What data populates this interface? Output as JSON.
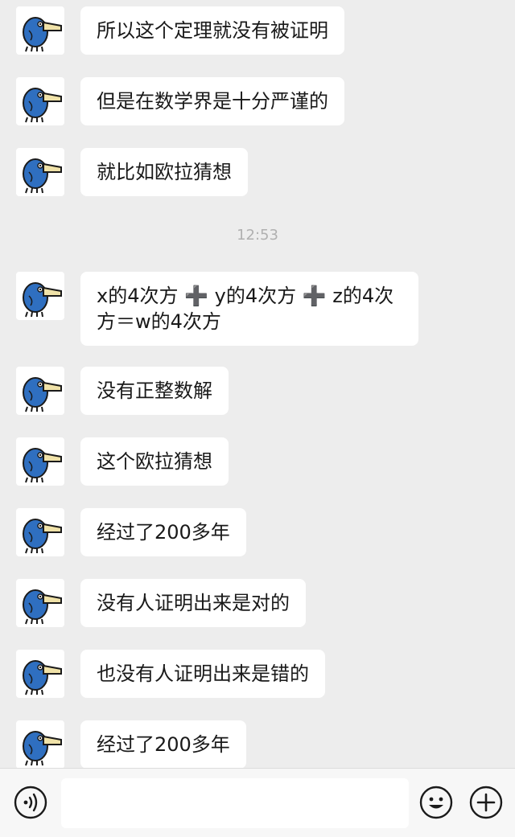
{
  "chat": {
    "timestamp": "12:53",
    "messages": [
      {
        "text": "所以这个定理就没有被证明"
      },
      {
        "text": "但是在数学界是十分严谨的"
      },
      {
        "text": "就比如欧拉猜想"
      },
      {
        "text": "x的4次方 ➕ y的4次方 ➕ z的4次方＝w的4次方"
      },
      {
        "text": "没有正整数解"
      },
      {
        "text": "这个欧拉猜想"
      },
      {
        "text": "经过了200多年"
      },
      {
        "text": "没有人证明出来是对的"
      },
      {
        "text": "也没有人证明出来是错的"
      },
      {
        "text": "经过了200多年"
      }
    ]
  },
  "input_bar": {
    "voice_icon": "voice-icon",
    "emoji_icon": "emoji-icon",
    "plus_icon": "plus-icon",
    "input_value": ""
  },
  "colors": {
    "background": "#ededed",
    "bubble": "#ffffff",
    "text": "#191919",
    "avatar_bird": "#2f6fc0",
    "avatar_beak": "#f0e2a8"
  }
}
